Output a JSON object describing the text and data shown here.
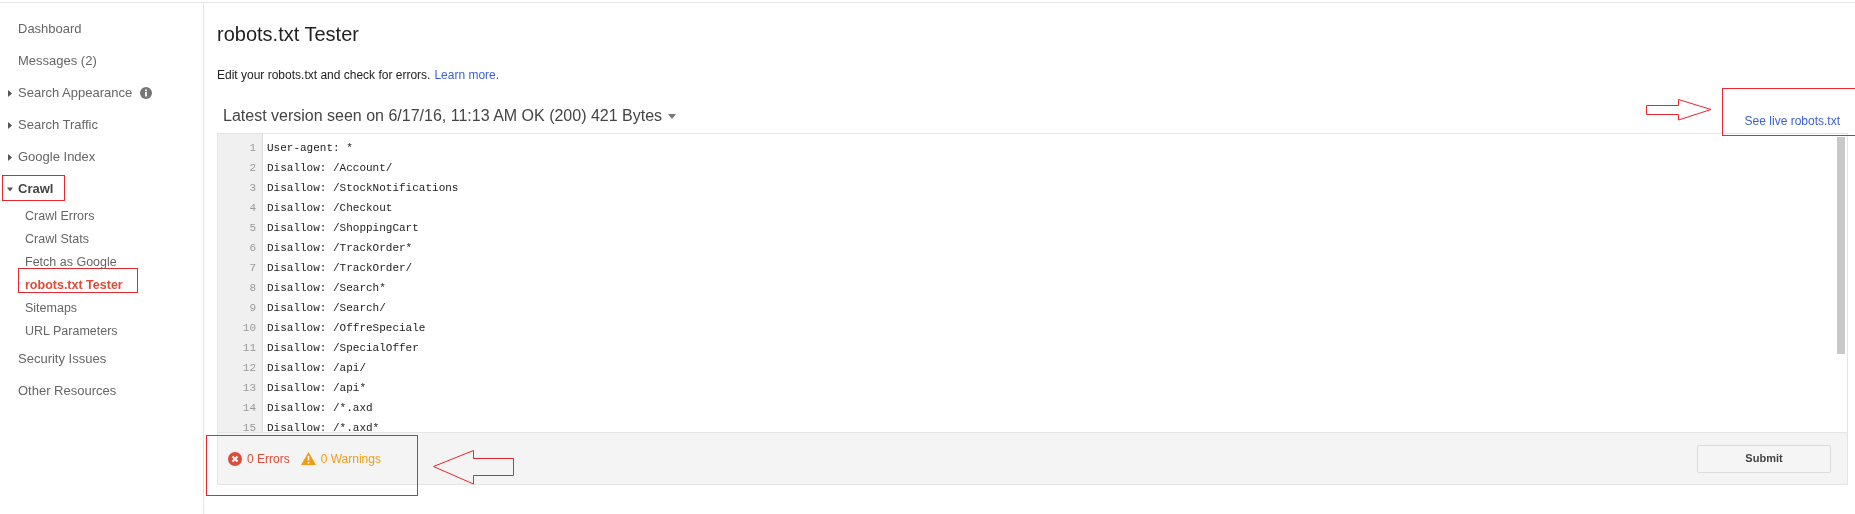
{
  "sidebar": {
    "items": [
      {
        "label": "Dashboard",
        "kind": "link",
        "selected": false
      },
      {
        "label": "Messages (2)",
        "kind": "link",
        "selected": false
      },
      {
        "label": "Search Appearance",
        "kind": "section",
        "info": true,
        "expanded": false,
        "selected": false
      },
      {
        "label": "Search Traffic",
        "kind": "section",
        "expanded": false,
        "selected": false
      },
      {
        "label": "Google Index",
        "kind": "section",
        "expanded": false,
        "selected": false
      },
      {
        "label": "Crawl",
        "kind": "section",
        "expanded": true,
        "selected": false,
        "children": [
          {
            "label": "Crawl Errors",
            "selected": false
          },
          {
            "label": "Crawl Stats",
            "selected": false
          },
          {
            "label": "Fetch as Google",
            "selected": false
          },
          {
            "label": "robots.txt Tester",
            "selected": true
          },
          {
            "label": "Sitemaps",
            "selected": false
          },
          {
            "label": "URL Parameters",
            "selected": false
          }
        ]
      },
      {
        "label": "Security Issues",
        "kind": "link",
        "selected": false
      },
      {
        "label": "Other Resources",
        "kind": "link",
        "selected": false
      }
    ]
  },
  "page": {
    "title": "robots.txt Tester",
    "description": "Edit your robots.txt and check for errors.",
    "learn_more": "Learn more.",
    "version": "Latest version seen on 6/17/16, 11:13 AM OK (200) 421 Bytes",
    "live_link": "See live robots.txt"
  },
  "editor": {
    "lines": [
      {
        "number": "1",
        "text": "User-agent: *"
      },
      {
        "number": "2",
        "text": "Disallow: /Account/"
      },
      {
        "number": "3",
        "text": "Disallow: /StockNotifications"
      },
      {
        "number": "4",
        "text": "Disallow: /Checkout"
      },
      {
        "number": "5",
        "text": "Disallow: /ShoppingCart"
      },
      {
        "number": "6",
        "text": "Disallow: /TrackOrder*"
      },
      {
        "number": "7",
        "text": "Disallow: /TrackOrder/"
      },
      {
        "number": "8",
        "text": "Disallow: /Search*"
      },
      {
        "number": "9",
        "text": "Disallow: /Search/"
      },
      {
        "number": "10",
        "text": "Disallow: /OffreSpeciale"
      },
      {
        "number": "11",
        "text": "Disallow: /SpecialOffer"
      },
      {
        "number": "12",
        "text": "Disallow: /api/"
      },
      {
        "number": "13",
        "text": "Disallow: /api*"
      },
      {
        "number": "14",
        "text": "Disallow: /*.axd"
      },
      {
        "number": "15",
        "text": "Disallow: /*.axd*"
      }
    ]
  },
  "footer": {
    "errors": "0 Errors",
    "warnings": "0 Warnings",
    "submit": "Submit"
  }
}
